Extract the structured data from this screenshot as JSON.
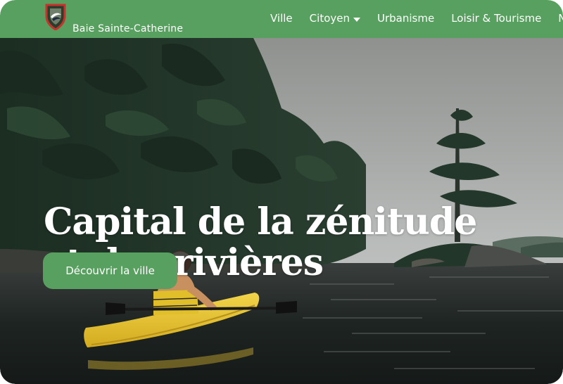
{
  "header": {
    "brand_name": "Baie Sainte-Catherine",
    "logo_icon": "municipal-crest-icon",
    "nav": [
      {
        "label": "Ville"
      },
      {
        "label": "Citoyen",
        "has_dropdown": true
      },
      {
        "label": "Urbanisme"
      },
      {
        "label": "Loisir & Tourisme"
      },
      {
        "label": "N"
      }
    ]
  },
  "hero": {
    "headline_line1": "Capital de la zénitude",
    "headline_line2": "et des rivières",
    "cta_label": "Découvrir la ville",
    "image": "kayaker-on-lake-with-pine-forest"
  },
  "colors": {
    "brand_green": "#58a05f",
    "text_light": "#ffffff"
  }
}
